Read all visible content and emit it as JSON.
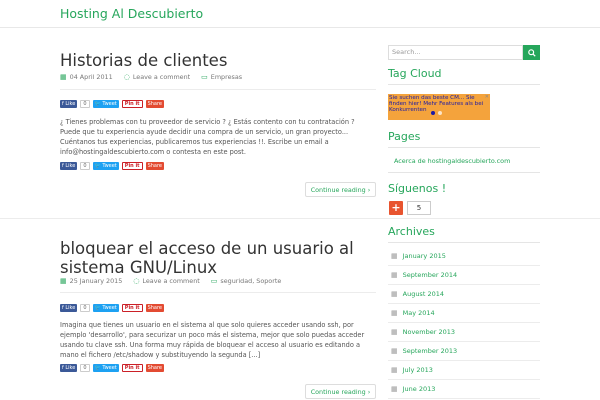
{
  "site": {
    "title": "Hosting Al Descubierto"
  },
  "posts": [
    {
      "title": "Historias de clientes",
      "date": "04 April 2011",
      "comments": "Leave a comment",
      "category": "Empresas",
      "excerpt": "¿ Tienes problemas con tu proveedor de servicio ? ¿ Estás contento con tu contratación ? Puede que tu experiencia ayude decidir una compra de un servicio, un gran proyecto... Cuéntanos tus experiencias, publicaremos tus experiencias !!. Escribe un email a info@hostingaldescubierto.com o contesta en este post.",
      "continue": "Continue reading"
    },
    {
      "title": "bloquear el acceso de un usuario al sistema GNU/Linux",
      "date": "25 January 2015",
      "comments": "Leave a comment",
      "category": "seguridad, Soporte",
      "excerpt": "Imagina que tienes un usuario en el sistema al que solo quieres acceder usando ssh, por ejemplo 'desarrollo', para securizar un poco más el sistema, mejor que solo puedas acceder usando tu clave ssh. Una forma muy rápida de bloquear el acceso al usuario es editando a mano el fichero /etc/shadow y substituyendo la segunda [...]",
      "continue": "Continue reading"
    }
  ],
  "share": {
    "like": "Like",
    "like_count": "0",
    "tweet": "Tweet",
    "pin": "Pin it",
    "share": "Share"
  },
  "sidebar": {
    "search_placeholder": "Search...",
    "tag_cloud_title": "Tag Cloud",
    "ad_text": "Sie suchen das beste CM... Sie finden hier! Mehr Features als bei Konkurrenten",
    "pages_title": "Pages",
    "page_link": "Acerca de hostingaldescubierto.com",
    "follow_title": "Síguenos !",
    "follow_count": "5",
    "archives_title": "Archives",
    "archives": [
      "January 2015",
      "September 2014",
      "August 2014",
      "May 2014",
      "November 2013",
      "September 2013",
      "July 2013",
      "June 2013"
    ]
  },
  "colors": {
    "accent": "#26a65b",
    "ad_bg": "#f4a33c",
    "follow": "#e8542f"
  },
  "icons": {
    "date": "calendar-icon",
    "comments": "comment-icon",
    "category": "folder-icon",
    "search": "search-icon",
    "archive": "calendar-icon"
  }
}
